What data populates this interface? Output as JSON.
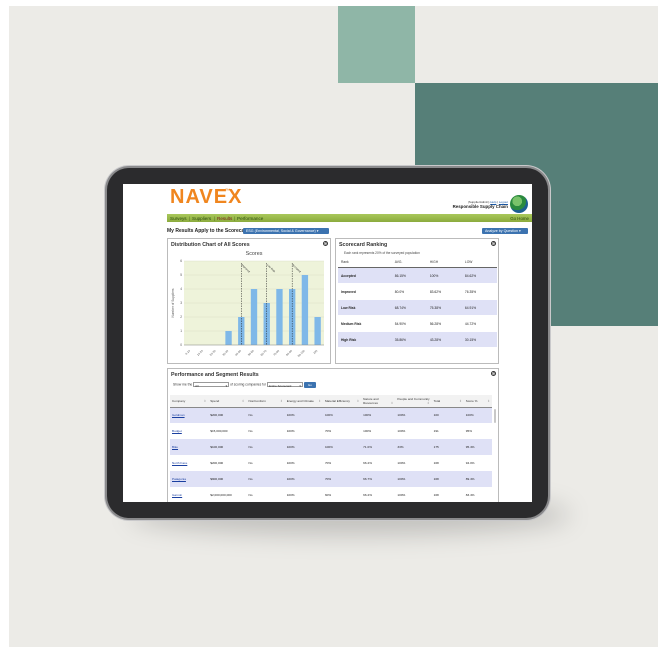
{
  "app": {
    "logo": "NAVEX",
    "logo_tm": "™",
    "user_links": {
      "user": "(SupplierAdmin)",
      "help": "Help",
      "logout": "Logout"
    },
    "product_title": "Responsible Supply Chain",
    "nav": [
      "Surveys",
      "Suppliers",
      "Results",
      "Performance"
    ],
    "nav_active": "Results",
    "go_home": "Go Home"
  },
  "heading": {
    "label": "My Results Apply to the Scorecard:",
    "scorecard": "ESG (Environmental, Social & Governance) ▾",
    "analyze_button": "Analyze by Question ▾"
  },
  "distribution": {
    "title": "Distribution Chart of All Scores",
    "chart_title": "Scores",
    "y_label": "Number of Suppliers"
  },
  "chart_data": {
    "type": "bar",
    "title": "Scores",
    "ylabel": "Number of Suppliers",
    "categories": [
      "0-10",
      "10-20",
      "20-30",
      "30-40",
      "40-50",
      "50-60",
      "60-70",
      "70-80",
      "80-90",
      "90-100",
      "100"
    ],
    "values": [
      0,
      0,
      0,
      1,
      2,
      4,
      3,
      4,
      4,
      5,
      2
    ],
    "ylim": [
      0,
      6
    ],
    "yticks": [
      0,
      1,
      2,
      3,
      4,
      5,
      6
    ],
    "grid": true,
    "marker_lines": [
      {
        "after_index": 4,
        "label": "Improved"
      },
      {
        "after_index": 6,
        "label": "Low Risk"
      },
      {
        "after_index": 8,
        "label": "Accepted"
      }
    ],
    "fill_color": "#7fb8e8",
    "plot_bg": "#eef3da"
  },
  "ranking": {
    "title": "Scorecard Ranking",
    "note": "Each rank represents 20% of the surveyed population",
    "columns": [
      "Rank",
      "AVG.",
      "HIGH",
      "LOW"
    ],
    "rows": [
      {
        "rank": "Accepted",
        "avg": "86.15%",
        "high": "100%",
        "low": "84.62%"
      },
      {
        "rank": "Improved",
        "avg": "80.0%",
        "high": "83.62%",
        "low": "76.35%"
      },
      {
        "rank": "Low Risk",
        "avg": "68.74%",
        "high": "75.38%",
        "low": "64.91%"
      },
      {
        "rank": "Medium Risk",
        "avg": "54.90%",
        "high": "56.28%",
        "low": "44.72%"
      },
      {
        "rank": "High Risk",
        "avg": "35.86%",
        "high": "43.28%",
        "low": "30.15%"
      }
    ]
  },
  "performance": {
    "title": "Performance and Segment Results",
    "filter_prefix": "Show me the",
    "filter_select": "All",
    "filter_mid": "of scoring companies for",
    "filter_scorecard": "Entire Scorecard",
    "go_label": "Go",
    "columns": [
      "Company",
      "Spend",
      "NonConform",
      "Energy and Climate",
      "Material Efficiency",
      "Nature and Resources",
      "People and Community",
      "Total",
      "Score %"
    ],
    "rows": [
      {
        "company": "Goldman",
        "spend": "$200,000",
        "nonconform": "No",
        "energy": "100%",
        "material": "100%",
        "nature": "100%",
        "people": "100%",
        "total": "100",
        "score": "100%"
      },
      {
        "company": "Budget",
        "spend": "$15,000,000",
        "nonconform": "No",
        "energy": "100%",
        "material": "70%",
        "nature": "100%",
        "people": "100%",
        "total": "191",
        "score": "95%"
      },
      {
        "company": "Bike",
        "spend": "$100,000",
        "nonconform": "No",
        "energy": "100%",
        "material": "100%",
        "nature": "71.0%",
        "people": "33%",
        "total": "175",
        "score": "95.4%"
      },
      {
        "company": "North Face",
        "spend": "$200,000",
        "nonconform": "No",
        "energy": "100%",
        "material": "70%",
        "nature": "66.2%",
        "people": "100%",
        "total": "168",
        "score": "94.0%"
      },
      {
        "company": "Patagonia",
        "spend": "$900,000",
        "nonconform": "No",
        "energy": "100%",
        "material": "70%",
        "nature": "66.7%",
        "people": "100%",
        "total": "168",
        "score": "89.4%"
      },
      {
        "company": "Garmin",
        "spend": "$2,000,000,000",
        "nonconform": "No",
        "energy": "100%",
        "material": "60%",
        "nature": "66.2%",
        "people": "100%",
        "total": "168",
        "score": "83.4%"
      }
    ]
  }
}
